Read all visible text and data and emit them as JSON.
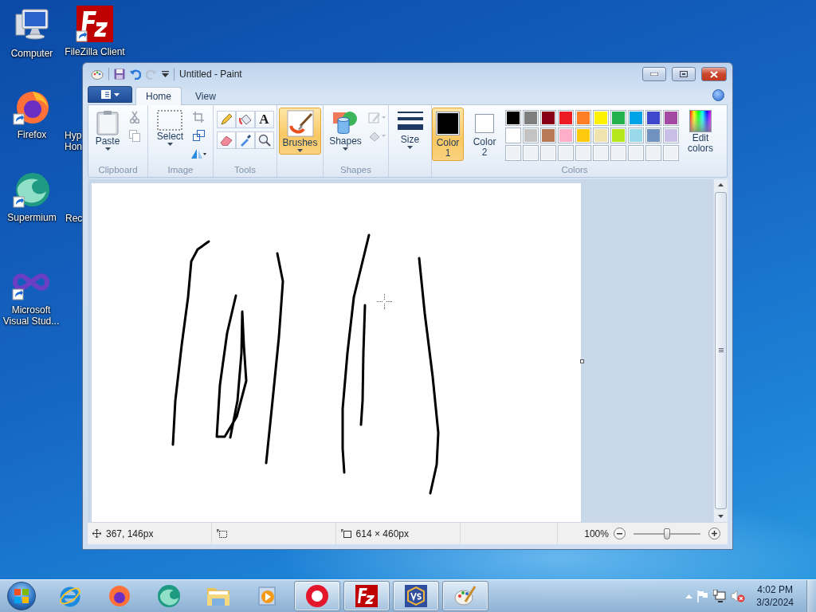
{
  "desktop_icons": [
    {
      "label": "Computer"
    },
    {
      "label": "FileZilla Client"
    },
    {
      "label": "Firefox"
    },
    {
      "label": "Hyp Hon"
    },
    {
      "label": "Supermium"
    },
    {
      "label": "Rec"
    },
    {
      "label": "Microsoft Visual Stud..."
    }
  ],
  "window": {
    "title": "Untitled - Paint",
    "tabs": [
      {
        "label": "Home",
        "selected": true
      },
      {
        "label": "View",
        "selected": false
      }
    ],
    "ribbon": {
      "clipboard": {
        "label": "Clipboard",
        "paste": "Paste"
      },
      "image": {
        "label": "Image",
        "select": "Select"
      },
      "tools": {
        "label": "Tools",
        "text_tool": "A"
      },
      "brushes": {
        "label": "Brushes",
        "selected": true
      },
      "shapes": {
        "label": "Shapes",
        "button": "Shapes"
      },
      "size": {
        "label": "Size"
      },
      "colors": {
        "label": "Colors",
        "color1": {
          "label": "Color 1",
          "color": "#000000",
          "selected": true
        },
        "color2": {
          "label": "Color 2",
          "color": "#ffffff",
          "selected": false
        },
        "edit": "Edit colors",
        "palette": [
          {
            "color": "#000000"
          },
          {
            "color": "#7f7f7f"
          },
          {
            "color": "#880015"
          },
          {
            "color": "#ed1c24"
          },
          {
            "color": "#ff7f27"
          },
          {
            "color": "#fff200"
          },
          {
            "color": "#22b14c"
          },
          {
            "color": "#00a2e8"
          },
          {
            "color": "#3f48cc"
          },
          {
            "color": "#a349a4"
          },
          {
            "color": "#ffffff"
          },
          {
            "color": "#c3c3c3"
          },
          {
            "color": "#b97a57"
          },
          {
            "color": "#ffaec9"
          },
          {
            "color": "#ffc90e"
          },
          {
            "color": "#efe4b0"
          },
          {
            "color": "#b5e61d"
          },
          {
            "color": "#99d9ea"
          },
          {
            "color": "#7092be"
          },
          {
            "color": "#c8bfe7"
          }
        ]
      }
    },
    "status_bar": {
      "cursor": "367, 146px",
      "size": "614 × 460px",
      "zoom": "100%",
      "zoom_slider": {
        "level": 0.5
      }
    }
  },
  "taskbar": {
    "items": [
      {
        "running": false
      },
      {
        "running": false
      },
      {
        "running": false
      },
      {
        "running": false
      },
      {
        "running": false
      },
      {
        "running": true
      },
      {
        "running": true
      },
      {
        "running": true
      },
      {
        "running": true
      }
    ],
    "clock": {
      "time": "4:02 PM",
      "date": "3/3/2024"
    }
  }
}
